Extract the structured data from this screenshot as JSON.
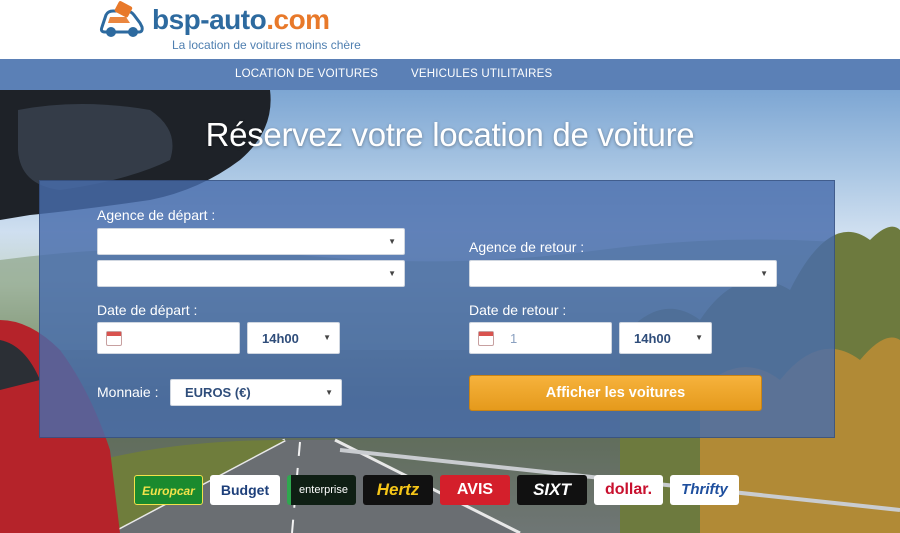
{
  "brand": {
    "name_main": "bsp-auto",
    "name_dot": ".com",
    "tagline": "La location de voitures moins chère"
  },
  "nav": {
    "items": [
      {
        "label": "LOCATION DE VOITURES"
      },
      {
        "label": "VEHICULES UTILITAIRES"
      }
    ]
  },
  "hero": {
    "title": "Réservez votre location de voiture"
  },
  "form": {
    "pickup_label": "Agence de départ :",
    "pickup_value_1": "",
    "pickup_value_2": "",
    "return_label": "Agence de retour :",
    "return_value": "",
    "departure_date_label": "Date de départ :",
    "departure_date_value": "",
    "departure_hour": "14h00",
    "return_date_label": "Date de retour :",
    "return_date_value": "1",
    "return_hour": "14h00",
    "currency_label": "Monnaie :",
    "currency_value": "EUROS (€)",
    "submit_label": "Afficher les voitures"
  },
  "partners": [
    {
      "name": "Europcar",
      "bg": "#1a8a2e",
      "color": "#f2e24a"
    },
    {
      "name": "Budget",
      "bg": "#ffffff",
      "color": "#1d3f7a"
    },
    {
      "name": "enterprise",
      "bg": "#0f1f14",
      "color": "#ffffff"
    },
    {
      "name": "Hertz",
      "bg": "#111111",
      "color": "#f5c518"
    },
    {
      "name": "AVIS",
      "bg": "#d41f2b",
      "color": "#ffffff"
    },
    {
      "name": "SIXT",
      "bg": "#111111",
      "color": "#ffffff"
    },
    {
      "name": "dollar.",
      "bg": "#ffffff",
      "color": "#c8102e"
    },
    {
      "name": "Thrifty",
      "bg": "#ffffff",
      "color": "#1e4f9e"
    }
  ],
  "colors": {
    "nav_bg": "#5b80b6",
    "panel_bg": "#486cac",
    "button_orange": "#f0a92f",
    "logo_blue": "#2d6a9f",
    "logo_orange": "#e8792a"
  }
}
